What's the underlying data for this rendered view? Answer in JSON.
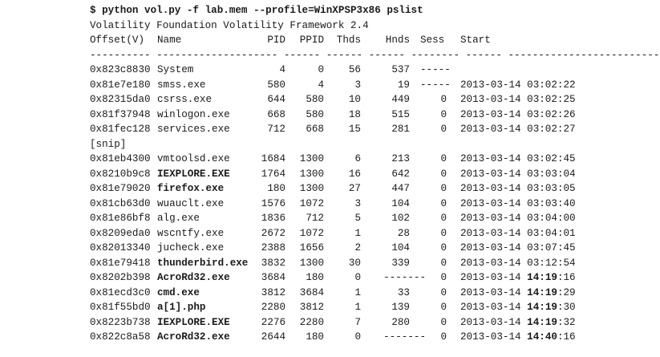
{
  "command": "$ python vol.py -f lab.mem --profile=WinXPSP3x86 pslist",
  "banner": "Volatility Foundation Volatility Framework 2.4",
  "headers": {
    "offset": "Offset(V)",
    "name": "Name",
    "pid": "PID",
    "ppid": "PPID",
    "thds": "Thds",
    "hnds": "Hnds",
    "sess": "Sess",
    "start": "Start"
  },
  "separator": "---------- -------------------- ------ ------ ------ -------- ------ ------------------------------",
  "rows_a": [
    {
      "offset": "0x823c8830",
      "name": "System",
      "pid": "4",
      "ppid": "0",
      "thds": "56",
      "hnds": "537",
      "sess": "-----",
      "start": ""
    },
    {
      "offset": "0x81e7e180",
      "name": "smss.exe",
      "pid": "580",
      "ppid": "4",
      "thds": "3",
      "hnds": "19",
      "sess": "-----",
      "start": "2013-03-14 03:02:22"
    },
    {
      "offset": "0x82315da0",
      "name": "csrss.exe",
      "pid": "644",
      "ppid": "580",
      "thds": "10",
      "hnds": "449",
      "sess": "0",
      "start": "2013-03-14 03:02:25"
    },
    {
      "offset": "0x81f37948",
      "name": "winlogon.exe",
      "pid": "668",
      "ppid": "580",
      "thds": "18",
      "hnds": "515",
      "sess": "0",
      "start": "2013-03-14 03:02:26"
    },
    {
      "offset": "0x81fec128",
      "name": "services.exe",
      "pid": "712",
      "ppid": "668",
      "thds": "15",
      "hnds": "281",
      "sess": "0",
      "start": "2013-03-14 03:02:27"
    }
  ],
  "snip": "[snip]",
  "rows_b": [
    {
      "offset": "0x81eb4300",
      "name": "vmtoolsd.exe",
      "pid": "1684",
      "ppid": "1300",
      "thds": "6",
      "hnds": "213",
      "sess": "0",
      "start_date": "2013-03-14",
      "start_hm": "03:02",
      "start_s": ":45",
      "bold_name": false,
      "bold_time": false
    },
    {
      "offset": "0x8210b9c8",
      "name": "IEXPLORE.EXE",
      "pid": "1764",
      "ppid": "1300",
      "thds": "16",
      "hnds": "642",
      "sess": "0",
      "start_date": "2013-03-14",
      "start_hm": "03:03",
      "start_s": ":04",
      "bold_name": true,
      "bold_time": false
    },
    {
      "offset": "0x81e79020",
      "name": "firefox.exe",
      "pid": "180",
      "ppid": "1300",
      "thds": "27",
      "hnds": "447",
      "sess": "0",
      "start_date": "2013-03-14",
      "start_hm": "03:03",
      "start_s": ":05",
      "bold_name": true,
      "bold_time": false
    },
    {
      "offset": "0x81cb63d0",
      "name": "wuauclt.exe",
      "pid": "1576",
      "ppid": "1072",
      "thds": "3",
      "hnds": "104",
      "sess": "0",
      "start_date": "2013-03-14",
      "start_hm": "03:03",
      "start_s": ":40",
      "bold_name": false,
      "bold_time": false
    },
    {
      "offset": "0x81e86bf8",
      "name": "alg.exe",
      "pid": "1836",
      "ppid": "712",
      "thds": "5",
      "hnds": "102",
      "sess": "0",
      "start_date": "2013-03-14",
      "start_hm": "03:04",
      "start_s": ":00",
      "bold_name": false,
      "bold_time": false
    },
    {
      "offset": "0x8209eda0",
      "name": "wscntfy.exe",
      "pid": "2672",
      "ppid": "1072",
      "thds": "1",
      "hnds": "28",
      "sess": "0",
      "start_date": "2013-03-14",
      "start_hm": "03:04",
      "start_s": ":01",
      "bold_name": false,
      "bold_time": false
    },
    {
      "offset": "0x82013340",
      "name": "jucheck.exe",
      "pid": "2388",
      "ppid": "1656",
      "thds": "2",
      "hnds": "104",
      "sess": "0",
      "start_date": "2013-03-14",
      "start_hm": "03:07",
      "start_s": ":45",
      "bold_name": false,
      "bold_time": false
    },
    {
      "offset": "0x81e79418",
      "name": "thunderbird.exe",
      "pid": "3832",
      "ppid": "1300",
      "thds": "30",
      "hnds": "339",
      "sess": "0",
      "start_date": "2013-03-14",
      "start_hm": "03:12",
      "start_s": ":54",
      "bold_name": true,
      "bold_time": false
    },
    {
      "offset": "0x8202b398",
      "name": "AcroRd32.exe",
      "pid": "3684",
      "ppid": "180",
      "thds": "0",
      "hnds": "-------",
      "sess": "0",
      "start_date": "2013-03-14",
      "start_hm": "14:19",
      "start_s": ":16",
      "bold_name": true,
      "bold_time": true
    },
    {
      "offset": "0x81ecd3c0",
      "name": "cmd.exe",
      "pid": "3812",
      "ppid": "3684",
      "thds": "1",
      "hnds": "33",
      "sess": "0",
      "start_date": "2013-03-14",
      "start_hm": "14:19",
      "start_s": ":29",
      "bold_name": true,
      "bold_time": true
    },
    {
      "offset": "0x81f55bd0",
      "name": "a[1].php",
      "pid": "2280",
      "ppid": "3812",
      "thds": "1",
      "hnds": "139",
      "sess": "0",
      "start_date": "2013-03-14",
      "start_hm": "14:19",
      "start_s": ":30",
      "bold_name": true,
      "bold_time": true
    },
    {
      "offset": "0x8223b738",
      "name": "IEXPLORE.EXE",
      "pid": "2276",
      "ppid": "2280",
      "thds": "7",
      "hnds": "280",
      "sess": "0",
      "start_date": "2013-03-14",
      "start_hm": "14:19",
      "start_s": ":32",
      "bold_name": true,
      "bold_time": true
    },
    {
      "offset": "0x822c8a58",
      "name": "AcroRd32.exe",
      "pid": "2644",
      "ppid": "180",
      "thds": "0",
      "hnds": "-------",
      "sess": "0",
      "start_date": "2013-03-14",
      "start_hm": "14:40",
      "start_s": ":16",
      "bold_name": true,
      "bold_time": true
    }
  ]
}
